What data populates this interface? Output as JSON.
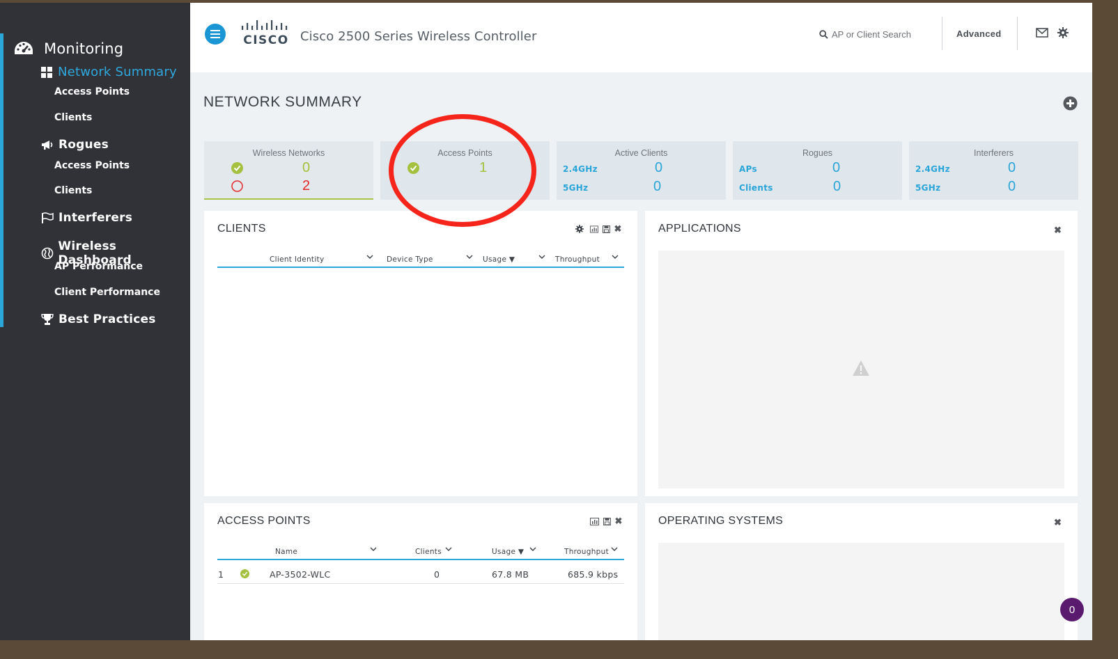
{
  "sidebar": {
    "monitoring": "Monitoring",
    "network_summary": "Network Summary",
    "ns_access_points": "Access Points",
    "ns_clients": "Clients",
    "rogues": "Rogues",
    "rogues_access_points": "Access Points",
    "rogues_clients": "Clients",
    "interferers": "Interferers",
    "wireless_dashboard": "Wireless Dashboard",
    "ap_performance": "AP Performance",
    "client_performance": "Client Performance",
    "best_practices": "Best Practices"
  },
  "header": {
    "logo_text": "CISCO",
    "title": "Cisco 2500 Series Wireless Controller",
    "search_placeholder": "AP or Client Search",
    "advanced": "Advanced"
  },
  "page": {
    "title": "NETWORK SUMMARY"
  },
  "stats": {
    "wireless_networks": {
      "title": "Wireless Networks",
      "ok": "0",
      "down": "2"
    },
    "access_points": {
      "title": "Access Points",
      "ok": "1"
    },
    "active_clients": {
      "title": "Active Clients",
      "row1_label": "2.4GHz",
      "row1_value": "0",
      "row2_label": "5GHz",
      "row2_value": "0"
    },
    "rogues": {
      "title": "Rogues",
      "row1_label": "APs",
      "row1_value": "0",
      "row2_label": "Clients",
      "row2_value": "0"
    },
    "interferers": {
      "title": "Interferers",
      "row1_label": "2.4GHz",
      "row1_value": "0",
      "row2_label": "5GHz",
      "row2_value": "0"
    }
  },
  "clients_panel": {
    "title": "CLIENTS",
    "columns": [
      "Client Identity",
      "Device Type",
      "Usage ▼",
      "Throughput"
    ]
  },
  "applications_panel": {
    "title": "APPLICATIONS"
  },
  "access_points_panel": {
    "title": "ACCESS POINTS",
    "columns": [
      "Name",
      "Clients",
      "Usage ▼",
      "Throughput"
    ],
    "rows": [
      {
        "index": "1",
        "name": "AP-3502-WLC",
        "clients": "0",
        "usage": "67.8 MB",
        "throughput": "685.9 kbps"
      }
    ]
  },
  "os_panel": {
    "title": "OPERATING SYSTEMS"
  },
  "notifications": {
    "count": "0"
  },
  "colors": {
    "accent_blue": "#2aa6d8",
    "ok_green": "#a4c13f",
    "error_red": "#e32a2a",
    "annotation_red": "#f5251b",
    "sidebar_bg": "#313238"
  }
}
